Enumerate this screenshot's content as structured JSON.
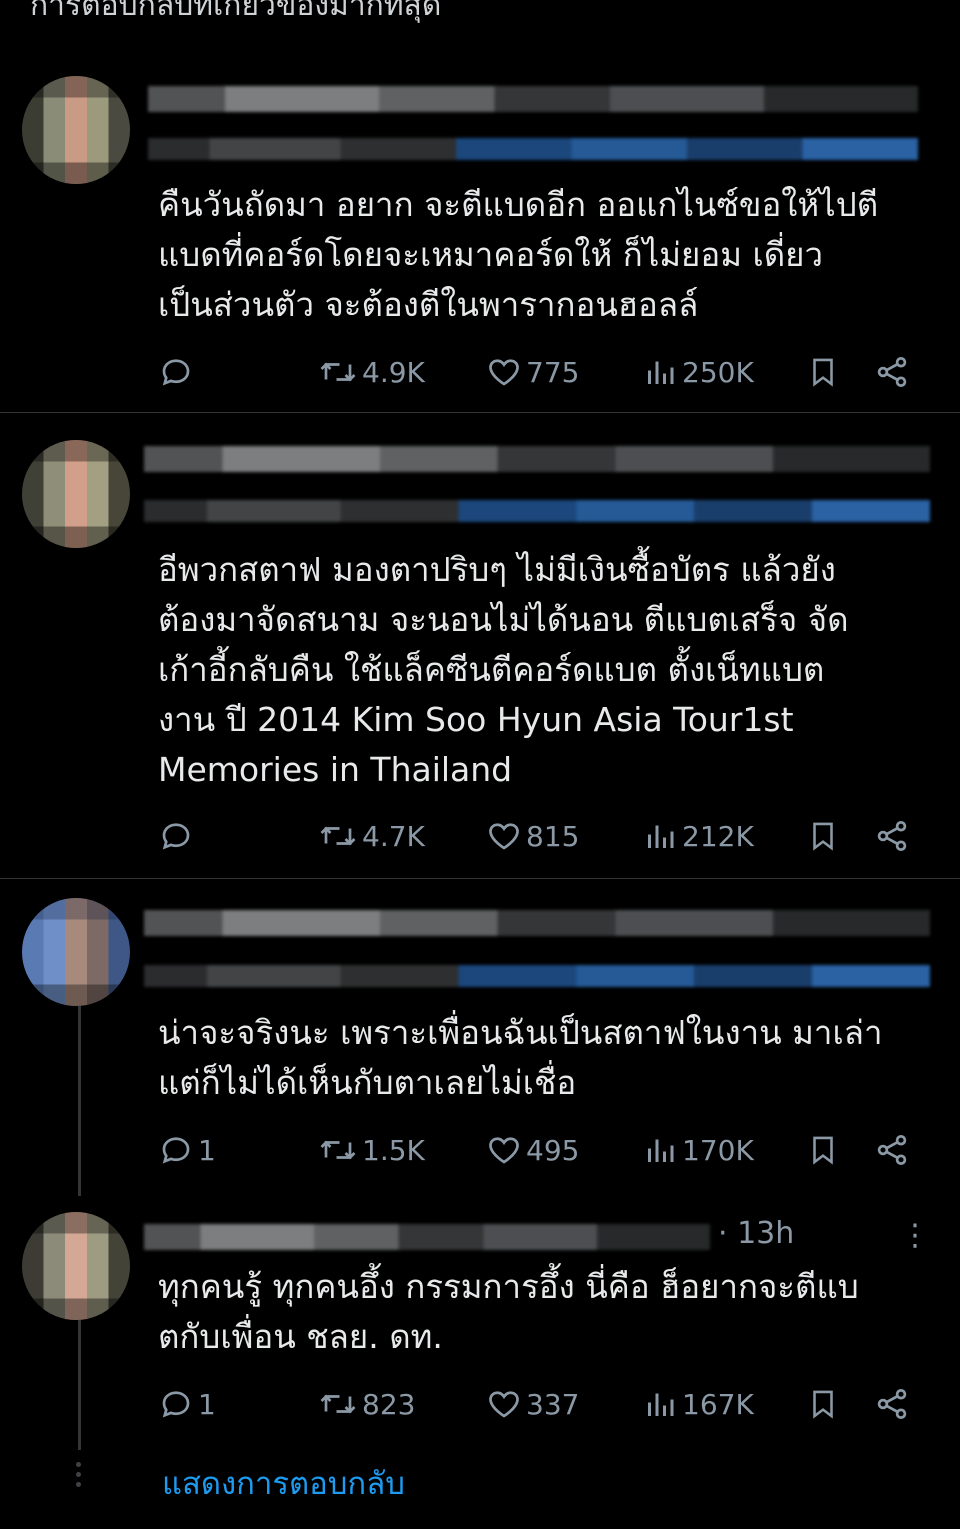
{
  "header": {
    "cut_text": "การตอบกลับที่เกี่ยวข้องมากที่สุด"
  },
  "posts": [
    {
      "text": "คืนวันถัดมา อยาก จะตีแบดอีก ออแกไนซ์ขอให้ไปตี\nแบดที่คอร์ดโดยจะเหมาคอร์ดให้ ก็ไม่ยอม เดี่ยว\nเป็นส่วนตัว จะต้องตีในพารากอนฮอลล์",
      "replies": "",
      "reposts": "4.9K",
      "likes": "775",
      "views": "250K"
    },
    {
      "text": "อีพวกสตาฟ มองตาปริบๆ ไม่มีเงินซื้อบัตร แล้วยัง\nต้องมาจัดสนาม จะนอนไม่ได้นอน ตีแบตเสร็จ จัด\nเก้าอี้กลับคืน ใช้แล็คซีนตีคอร์ดแบต ตั้งเน็ทแบต\nงาน ปี 2014 Kim Soo Hyun Asia Tour1st\nMemories in Thailand",
      "replies": "",
      "reposts": "4.7K",
      "likes": "815",
      "views": "212K"
    },
    {
      "text": "น่าจะจริงนะ เพราะเพื่อนฉันเป็นสตาฟในงาน มาเล่า\nแต่ก็ไม่ได้เห็นกับตาเลยไม่เชื่อ",
      "replies": "1",
      "reposts": "1.5K",
      "likes": "495",
      "views": "170K"
    },
    {
      "time": "· 13h",
      "text": "ทุกคนรู้ ทุกคนอึ้ง กรรมการอึ้ง นี่คือ ฮ็อยากจะตีแบ\nตกับเพื่อน ชลย. ดท.",
      "replies": "1",
      "reposts": "823",
      "likes": "337",
      "views": "167K"
    }
  ],
  "show_replies_label": "แสดงการตอบกลับ",
  "colors": {
    "background": "#000000",
    "text": "#e7e9ea",
    "muted": "#8b98a5",
    "link": "#1d9bf0",
    "divider": "#2f3336"
  }
}
